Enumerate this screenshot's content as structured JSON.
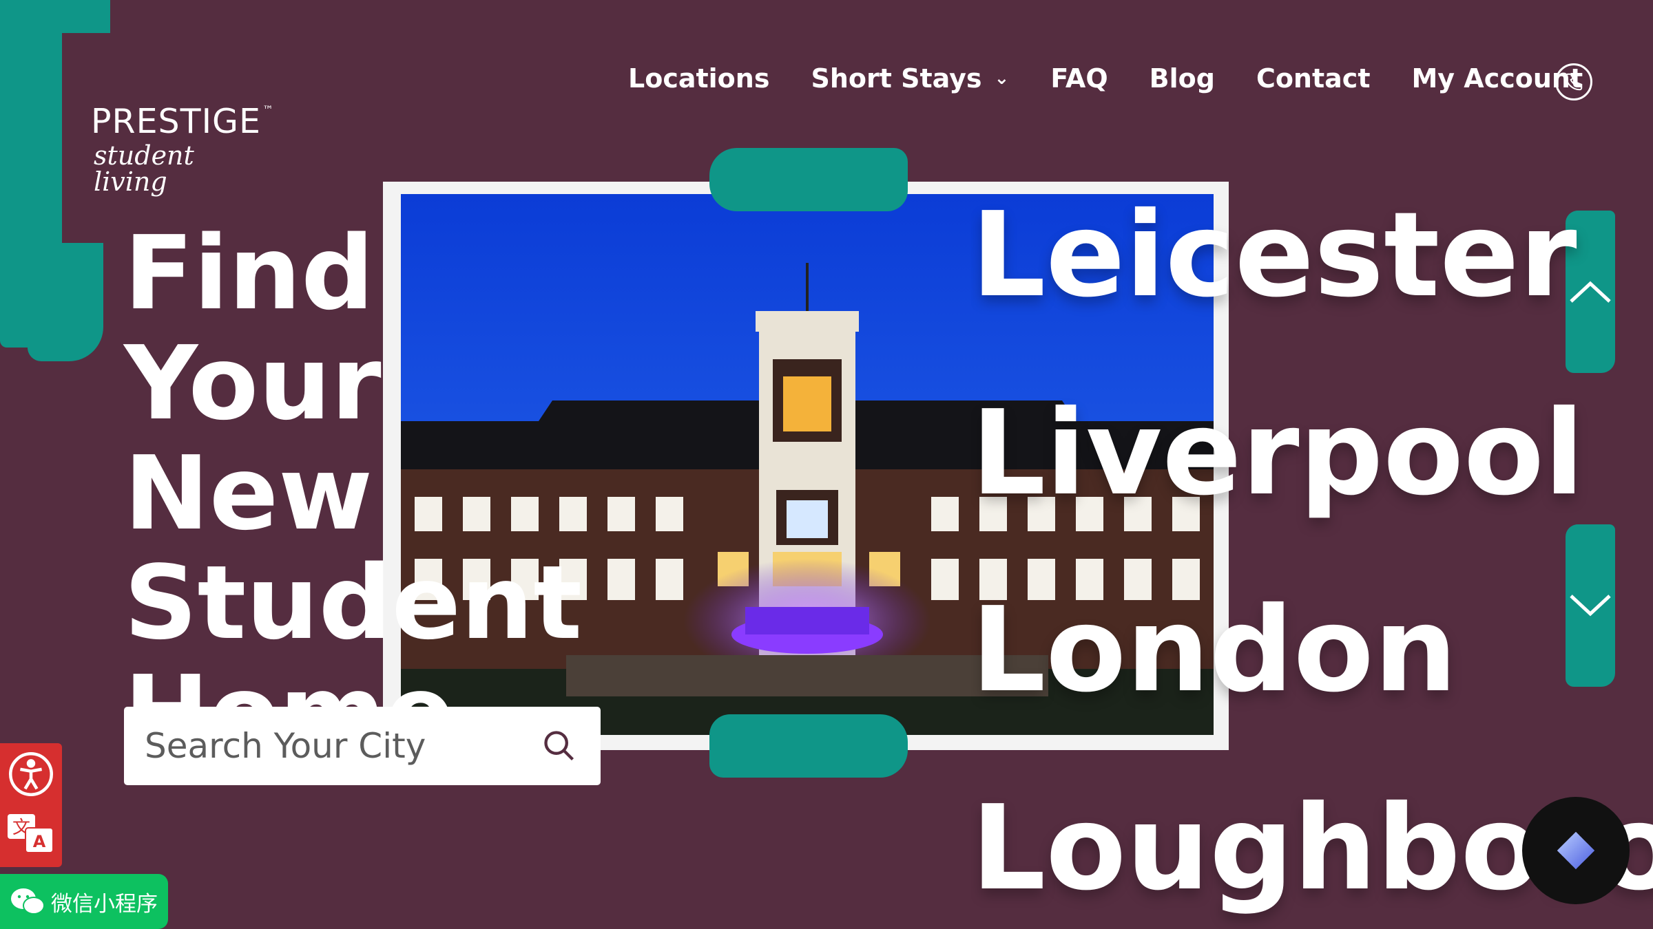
{
  "logo": {
    "name": "PRESTIGE",
    "trademark": "™",
    "tagline": "student living"
  },
  "nav": {
    "items": [
      {
        "label": "Locations"
      },
      {
        "label": "Short Stays"
      },
      {
        "label": "FAQ"
      },
      {
        "label": "Blog"
      },
      {
        "label": "Contact"
      },
      {
        "label": "My Account"
      }
    ],
    "phone_icon": "phone-icon"
  },
  "hero": {
    "title_lines": [
      "Find Your",
      "New",
      "Student",
      "Home"
    ]
  },
  "search": {
    "placeholder": "Search Your City",
    "icon": "search-icon"
  },
  "cities": [
    "Leicester",
    "Liverpool",
    "London",
    "Loughborough"
  ],
  "carousel": {
    "up_icon": "chevron-up-icon",
    "down_icon": "chevron-down-icon"
  },
  "widgets": {
    "accessibility_icon": "accessibility-icon",
    "translate_icon": "translate-icon",
    "wechat_label": "微信小程序",
    "chat_icon": "chat-assistant-icon"
  },
  "colors": {
    "background": "#552d40",
    "accent": "#0f9688",
    "wechat": "#0dc160",
    "a11y": "#d62f2f"
  }
}
